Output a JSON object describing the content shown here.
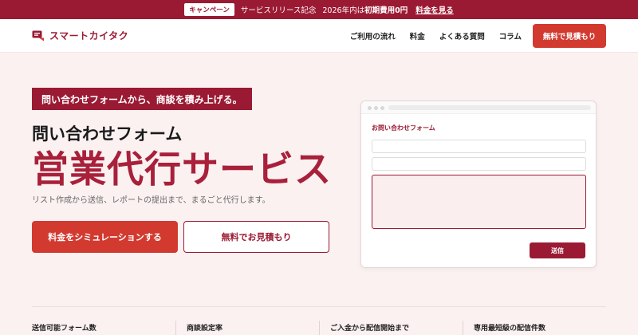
{
  "promo": {
    "badge": "キャンペーン",
    "text": "サービスリリース記念",
    "year_text": "2026年内は",
    "highlight": "初期費用0円",
    "link": "料金を見る"
  },
  "header": {
    "logo_text": "スマートカイタク",
    "nav": [
      "ご利用の流れ",
      "料金",
      "よくある質問",
      "コラム"
    ],
    "cta": "無料で見積もり"
  },
  "hero": {
    "tag": "問い合わせフォームから、商談を積み上げる。",
    "subhead": "問い合わせフォーム",
    "headline": "営業代行サービス",
    "description": "リスト作成から送信、レポートの提出まで、まるごと代行します。",
    "primary_button": "料金をシミュレーションする",
    "secondary_button": "無料でお見積もり"
  },
  "form_mock": {
    "title": "お問い合わせフォーム",
    "send_button": "送信"
  },
  "stats": [
    {
      "label": "送信可能フォーム数"
    },
    {
      "label": "商談設定率"
    },
    {
      "label": "ご入金から配信開始まで"
    },
    {
      "label": "専用最短級の配信件数"
    }
  ],
  "colors": {
    "brand": "#9b1a33",
    "accent": "#d23a30",
    "background": "#fbf1f1"
  }
}
